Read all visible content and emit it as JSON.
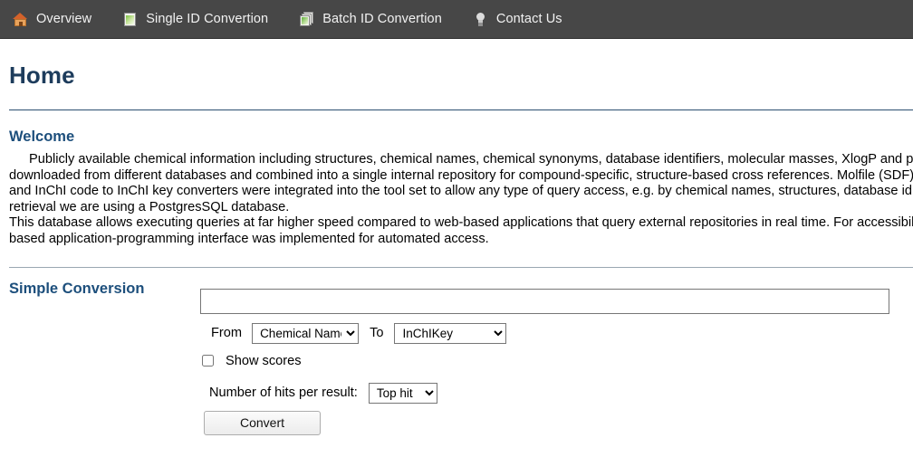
{
  "nav": {
    "items": [
      {
        "label": "Overview",
        "icon": "home-icon"
      },
      {
        "label": "Single ID Convertion",
        "icon": "document-icon"
      },
      {
        "label": "Batch ID Convertion",
        "icon": "stacked-documents-icon"
      },
      {
        "label": "Contact Us",
        "icon": "lightbulb-icon"
      }
    ]
  },
  "page": {
    "title": "Home"
  },
  "welcome": {
    "heading": "Welcome",
    "paragraph_lines": [
      "Publicly available chemical information including structures, chemical names, chemical synonyms, database identifiers, molecular masses, XlogP and pro",
      "downloaded from different databases and combined into a single internal repository for compound-specific, structure-based cross references. Molfile (SDF)",
      "and InChI code to InChI key converters were integrated into the tool set to allow any type of query access, e.g. by chemical names, structures, database id",
      "retrieval we are using a PostgresSQL database.",
      "This database allows executing queries at far higher speed compared to web-based applications that query external repositories in real time. For accessibil",
      "based application-programming interface was implemented for automated access."
    ]
  },
  "conversion": {
    "heading": "Simple Conversion",
    "query_value": "",
    "query_placeholder": "",
    "from_label": "From",
    "from_selected": "Chemical Name",
    "to_label": "To",
    "to_selected": "InChIKey",
    "show_scores_label": "Show scores",
    "show_scores_checked": false,
    "hits_label": "Number of hits per result:",
    "hits_selected": "Top hit",
    "convert_label": "Convert"
  },
  "colors": {
    "navbar_bg": "#474747",
    "nav_text": "#f2f2f2",
    "heading": "#1d3c5c",
    "section_heading": "#1d4f7c",
    "rule": "#2b4f70"
  }
}
